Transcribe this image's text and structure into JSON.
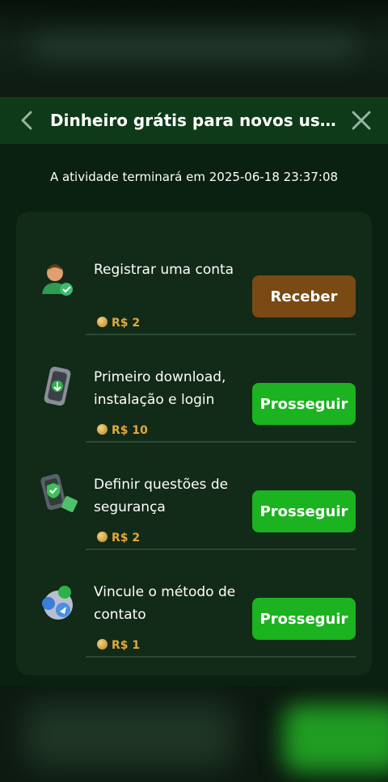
{
  "header": {
    "title": "Dinheiro grátis para novos us...",
    "back_icon": "chevron-left-icon",
    "close_icon": "close-icon"
  },
  "countdown": "A atividade terminará em 2025-06-18 23:37:08",
  "tasks": [
    {
      "label": "Registrar uma conta",
      "reward": "R$ 2",
      "icon": "user-check-icon",
      "button": "Receber",
      "button_color": "#7a4a14"
    },
    {
      "label": "Primeiro download, instalação e login",
      "reward": "R$ 10",
      "icon": "phone-download-icon",
      "button": "Prosseguir",
      "button_color": "#1bb31f"
    },
    {
      "label": "Definir questões de segurança",
      "reward": "R$ 2",
      "icon": "phone-shield-icon",
      "button": "Prosseguir",
      "button_color": "#1bb31f"
    },
    {
      "label": "Vincule o método de contato",
      "reward": "R$ 1",
      "icon": "contact-apps-icon",
      "button": "Prosseguir",
      "button_color": "#1bb31f"
    }
  ]
}
